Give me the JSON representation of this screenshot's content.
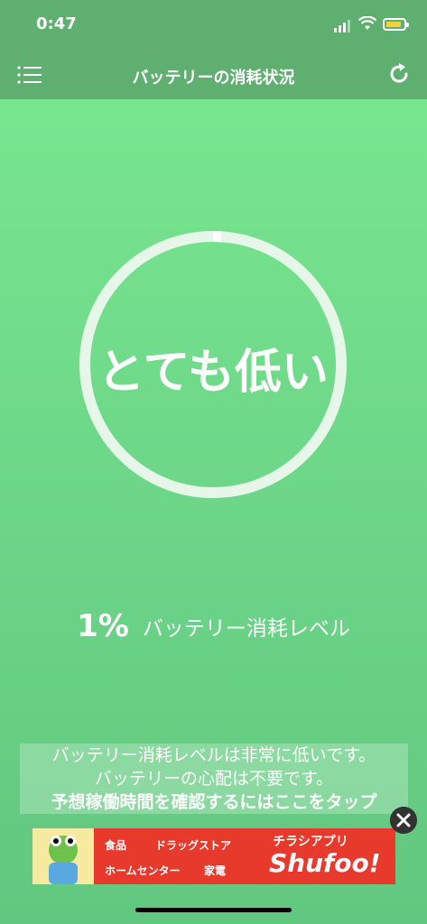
{
  "status_bar": {
    "time": "0:47"
  },
  "nav": {
    "title": "バッテリーの消耗状況"
  },
  "gauge": {
    "label": "とても低い",
    "level_percent": 1
  },
  "level": {
    "percent_text": "1%",
    "label": "バッテリー消耗レベル"
  },
  "message": {
    "line1": "バッテリー消耗レベルは非常に低いです。",
    "line2": "バッテリーの心配は不要です。",
    "line3": "予想稼働時間を確認するにはここをタップ"
  },
  "ad": {
    "cat_food": "食品",
    "cat_drugstore": "ドラッグストア",
    "cat_home": "ホームセンター",
    "cat_electronics": "家電",
    "app_label": "チラシアプリ",
    "logo": "Shufoo!"
  },
  "colors": {
    "bar": "#5fb070",
    "ad": "#e8392d",
    "ring": "#e6f7ea"
  },
  "icons": {
    "menu": "list-icon",
    "refresh": "refresh-icon",
    "close": "close-icon"
  }
}
